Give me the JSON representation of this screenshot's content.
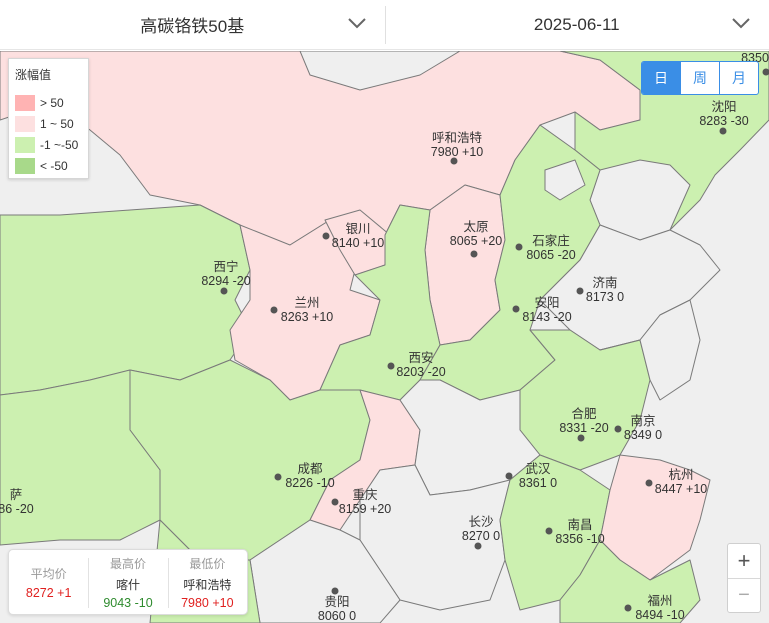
{
  "header": {
    "product": "高碳铬铁50基",
    "date": "2025-06-11"
  },
  "legend": {
    "title": "涨幅值",
    "items": [
      {
        "label": "> 50",
        "color": "#ffb3b3"
      },
      {
        "label": "1 ~ 50",
        "color": "#fde0e0"
      },
      {
        "label": "-1 ~-50",
        "color": "#ccf0b0"
      },
      {
        "label": "< -50",
        "color": "#a8d98a"
      }
    ]
  },
  "period_toggle": {
    "day": "日",
    "week": "周",
    "month": "月",
    "selected": "日"
  },
  "colors": {
    "rise": "#fde0e0",
    "fall": "#ccf0b0",
    "none": "#efefef",
    "accent": "#3a8ee6"
  },
  "cities": [
    {
      "id": "huhehaote",
      "name": "呼和浩特",
      "value": "7980 +10"
    },
    {
      "id": "shenyang",
      "name": "沈阳",
      "value": "8283 -30"
    },
    {
      "id": "topright",
      "name": "",
      "value": "8350"
    },
    {
      "id": "yinchuan",
      "name": "银川",
      "value": "8140 +10"
    },
    {
      "id": "taiyuan",
      "name": "太原",
      "value": "8065 +20"
    },
    {
      "id": "shijiazhuang",
      "name": "石家庄",
      "value": "8065 -20"
    },
    {
      "id": "xining",
      "name": "西宁",
      "value": "8294 -20"
    },
    {
      "id": "jinan",
      "name": "济南",
      "value": "8173 0"
    },
    {
      "id": "lanzhou",
      "name": "兰州",
      "value": "8263 +10"
    },
    {
      "id": "anyang",
      "name": "安阳",
      "value": "8143 -20"
    },
    {
      "id": "xian",
      "name": "西安",
      "value": "8203 -20"
    },
    {
      "id": "hefei",
      "name": "合肥",
      "value": "8331 -20"
    },
    {
      "id": "nanjing",
      "name": "南京",
      "value": "8349 0"
    },
    {
      "id": "chengdu",
      "name": "成都",
      "value": "8226 -10"
    },
    {
      "id": "wuhan",
      "name": "武汉",
      "value": "8361 0"
    },
    {
      "id": "hangzhou",
      "name": "杭州",
      "value": "8447 +10"
    },
    {
      "id": "lasa",
      "name": "萨",
      "value": "86 -20"
    },
    {
      "id": "chongqing",
      "name": "重庆",
      "value": "8159 +20"
    },
    {
      "id": "changsha",
      "name": "长沙",
      "value": "8270 0"
    },
    {
      "id": "nanchang",
      "name": "南昌",
      "value": "8356 -10"
    },
    {
      "id": "guiyang",
      "name": "贵阳",
      "value": "8060 0"
    },
    {
      "id": "fuzhou",
      "name": "福州",
      "value": "8494 -10"
    }
  ],
  "stats": {
    "avg": {
      "label": "平均价",
      "value": "8272 +1"
    },
    "max": {
      "label": "最高价",
      "city": "喀什",
      "value": "9043 -10"
    },
    "min": {
      "label": "最低价",
      "city": "呼和浩特",
      "value": "7980 +10"
    }
  },
  "zoom": {
    "in": "+",
    "out": "−"
  }
}
